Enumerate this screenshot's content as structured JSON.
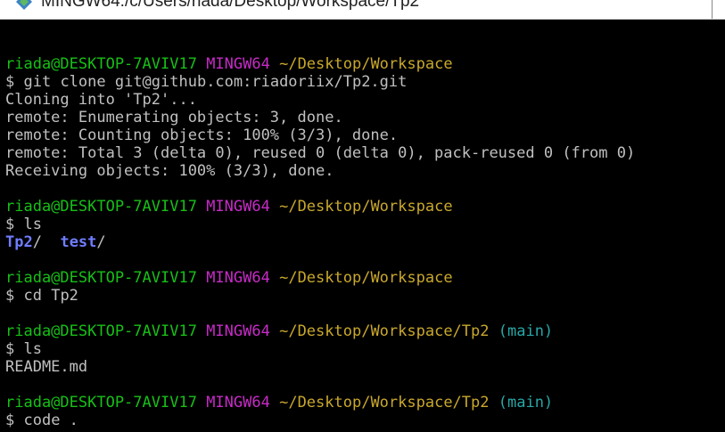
{
  "window": {
    "title": "MINGW64:/c/Users/riada/Desktop/Workspace/Tp2",
    "icon": "git-bash-icon"
  },
  "prompt": {
    "user": "riada@DESKTOP-7AVIV17",
    "env": "MINGW64",
    "path_workspace": "~/Desktop/Workspace",
    "path_tp2": "~/Desktop/Workspace/Tp2",
    "branch": "(main)",
    "symbol": "$"
  },
  "commands": {
    "clone": "git clone git@github.com:riadoriix/Tp2.git",
    "ls": "ls",
    "cd": "cd Tp2",
    "code": "code ."
  },
  "output": {
    "cloning": "Cloning into 'Tp2'...",
    "enumerating": "remote: Enumerating objects: 3, done.",
    "counting": "remote: Counting objects: 100% (3/3), done.",
    "total": "remote: Total 3 (delta 0), reused 0 (delta 0), pack-reused 0 (from 0)",
    "receiving": "Receiving objects: 100% (3/3), done.",
    "ls_dirs": [
      {
        "name": "Tp2",
        "suffix": "/"
      },
      {
        "name": "test",
        "suffix": "/"
      }
    ],
    "ls_files": "README.md"
  },
  "colors": {
    "user": "#17c017",
    "env": "#c72bc7",
    "path": "#c9a82c",
    "branch": "#28a6a6",
    "dir": "#6f7dff",
    "text": "#c0c0c0",
    "background": "#000000"
  }
}
